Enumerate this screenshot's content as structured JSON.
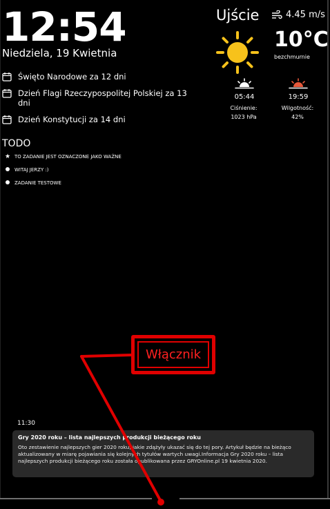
{
  "clock": {
    "time": "12:54",
    "date": "Niedziela, 19 Kwietnia"
  },
  "events": [
    {
      "icon": "calendar-icon",
      "text": "Święto Narodowe za 12 dni"
    },
    {
      "icon": "calendar-icon",
      "text": "Dzień Flagi Rzeczypospolitej Polskiej za 13 dni"
    },
    {
      "icon": "calendar-icon",
      "text": "Dzień Konstytucji za 14 dni"
    }
  ],
  "todo": {
    "title": "TODO",
    "items": [
      {
        "icon": "star-icon",
        "text": "TO ZADANIE JEST OZNACZONE JAKO WAŻNE"
      },
      {
        "icon": "dot-icon",
        "text": "WITAJ JERZY :)"
      },
      {
        "icon": "dot-icon",
        "text": "ZADANIE TESTOWE"
      }
    ]
  },
  "weather": {
    "city": "Ujście",
    "wind": "4.45 m/s",
    "temperature": "10°C",
    "condition": "bezchmurnie",
    "sunrise": "05:44",
    "sunset": "19:59",
    "pressure_label": "Ciśnienie:",
    "pressure_value": "1023 hPa",
    "humidity_label": "Wilgotność:",
    "humidity_value": "42%",
    "sun_color": "#f7c21b",
    "sunset_color": "#e8583a"
  },
  "news": {
    "time": "11:30",
    "title": "Gry 2020 roku – lista najlepszych produkcji bieżącego roku",
    "body": "Oto zestawienie najlepszych gier 2020 roku, jakie zdążyły ukazać się do tej pory. Artykuł będzie na bieżąco aktualizowany w miarę pojawiania się kolejnych tytułów wartych uwagi.Informacja Gry 2020 roku – lista najlepszych produkcji bieżącego roku została opublikowana przez GRYOnline.pl 19 kwietnia 2020."
  },
  "annotation": {
    "label": "Włącznik",
    "color": "#e00000"
  }
}
